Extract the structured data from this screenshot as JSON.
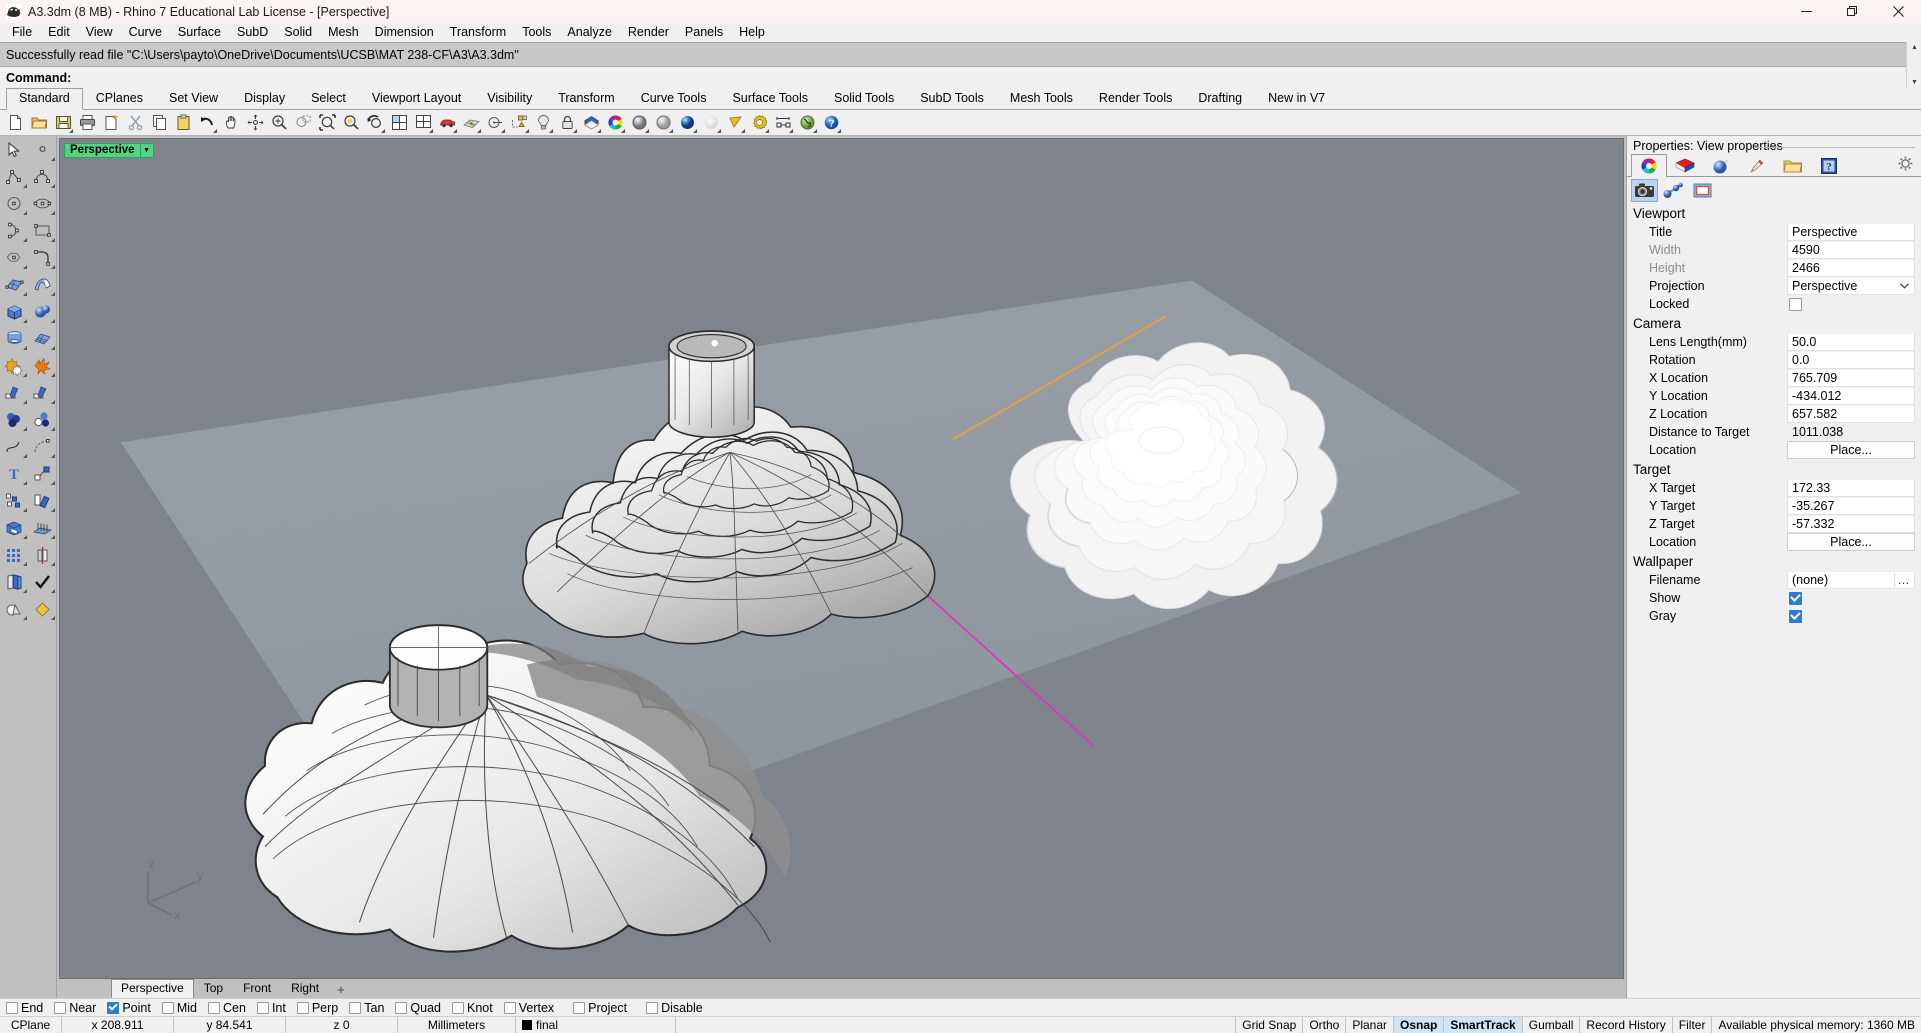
{
  "window": {
    "title": "A3.3dm (8 MB) - Rhino 7 Educational Lab License - [Perspective]",
    "app_icon": "rhino-logo-icon",
    "minimize": "–",
    "restore": "❐",
    "close": "✕"
  },
  "menubar": {
    "items": [
      {
        "label": "File"
      },
      {
        "label": "Edit"
      },
      {
        "label": "View"
      },
      {
        "label": "Curve"
      },
      {
        "label": "Surface"
      },
      {
        "label": "SubD"
      },
      {
        "label": "Solid"
      },
      {
        "label": "Mesh"
      },
      {
        "label": "Dimension"
      },
      {
        "label": "Transform"
      },
      {
        "label": "Tools"
      },
      {
        "label": "Analyze"
      },
      {
        "label": "Render"
      },
      {
        "label": "Panels"
      },
      {
        "label": "Help"
      }
    ]
  },
  "command": {
    "history": "Successfully read file \"C:\\Users\\payto\\OneDrive\\Documents\\UCSB\\MAT 238-CF\\A3\\A3.3dm\"",
    "prompt_label": "Command:",
    "prompt_value": "",
    "scroll_up": "▲",
    "scroll_down": "▼"
  },
  "toolbar_tabs": {
    "active": "Standard",
    "items": [
      {
        "label": "Standard"
      },
      {
        "label": "CPlanes"
      },
      {
        "label": "Set View"
      },
      {
        "label": "Display"
      },
      {
        "label": "Select"
      },
      {
        "label": "Viewport Layout"
      },
      {
        "label": "Visibility"
      },
      {
        "label": "Transform"
      },
      {
        "label": "Curve Tools"
      },
      {
        "label": "Surface Tools"
      },
      {
        "label": "Solid Tools"
      },
      {
        "label": "SubD Tools"
      },
      {
        "label": "Mesh Tools"
      },
      {
        "label": "Render Tools"
      },
      {
        "label": "Drafting"
      },
      {
        "label": "New in V7"
      }
    ]
  },
  "main_toolbar": {
    "buttons": [
      {
        "name": "new-file-icon",
        "tip": "New"
      },
      {
        "name": "open-file-icon",
        "tip": "Open"
      },
      {
        "name": "save-file-icon",
        "tip": "Save"
      },
      {
        "name": "print-icon",
        "tip": "Print"
      },
      {
        "name": "cut-page-icon",
        "tip": "Cut page"
      },
      {
        "name": "scissors-cut-icon",
        "tip": "Cut"
      },
      {
        "name": "copy-icon",
        "tip": "Copy"
      },
      {
        "name": "paste-clipboard-icon",
        "tip": "Paste"
      },
      {
        "name": "undo-arrow-icon",
        "tip": "Undo"
      },
      {
        "name": "pan-hand-icon",
        "tip": "Pan"
      },
      {
        "name": "rotate-view-icon",
        "tip": "Rotate view"
      },
      {
        "name": "zoom-in-icon",
        "tip": "Zoom in"
      },
      {
        "name": "zoom-window-icon",
        "tip": "Zoom window"
      },
      {
        "name": "zoom-extents-icon",
        "tip": "Zoom extents"
      },
      {
        "name": "zoom-selected-icon",
        "tip": "Zoom selected"
      },
      {
        "name": "zoom-previous-icon",
        "tip": "Zoom previous"
      },
      {
        "name": "viewport-4-icon",
        "tip": "4 viewports"
      },
      {
        "name": "viewport-split-icon",
        "tip": "Split viewport"
      },
      {
        "name": "car-render-icon",
        "tip": "Render"
      },
      {
        "name": "cplane-grid-icon",
        "tip": "CPlane"
      },
      {
        "name": "named-view-icon",
        "tip": "Named view"
      },
      {
        "name": "layer-state-icon",
        "tip": "Layers"
      },
      {
        "name": "light-bulb-icon",
        "tip": "Lights"
      },
      {
        "name": "lock-icon",
        "tip": "Lock"
      },
      {
        "name": "layers-stack-icon",
        "tip": "Layers panel"
      },
      {
        "name": "color-wheel-icon",
        "tip": "Color"
      },
      {
        "name": "shaded-sphere-icon",
        "tip": "Shaded"
      },
      {
        "name": "ghosted-sphere-icon",
        "tip": "Ghosted"
      },
      {
        "name": "rendered-sphere-icon",
        "tip": "Rendered"
      },
      {
        "name": "arctic-sphere-icon",
        "tip": "Arctic"
      },
      {
        "name": "cone-display-icon",
        "tip": "Display mode"
      },
      {
        "name": "gear-options-icon",
        "tip": "Options"
      },
      {
        "name": "dimension-icon",
        "tip": "Dimension"
      },
      {
        "name": "earth-globe-icon",
        "tip": "Globe"
      },
      {
        "name": "help-question-icon",
        "tip": "Help"
      }
    ]
  },
  "left_palette": {
    "buttons": [
      {
        "name": "select-arrow-icon"
      },
      {
        "name": "point-icon"
      },
      {
        "name": "polyline-icon"
      },
      {
        "name": "curve-icon"
      },
      {
        "name": "circle-icon"
      },
      {
        "name": "ellipse-icon"
      },
      {
        "name": "arc-icon"
      },
      {
        "name": "rectangle-icon"
      },
      {
        "name": "polygon-icon"
      },
      {
        "name": "fillet-curve-icon"
      },
      {
        "name": "surface-from-points-icon"
      },
      {
        "name": "loft-surface-icon"
      },
      {
        "name": "box-solid-icon"
      },
      {
        "name": "sphere-solid-icon"
      },
      {
        "name": "cylinder-solid-icon"
      },
      {
        "name": "mesh-icon"
      },
      {
        "name": "boolean-union-icon"
      },
      {
        "name": "explode-icon"
      },
      {
        "name": "trim-icon"
      },
      {
        "name": "split-icon"
      },
      {
        "name": "boolean-difference-icon"
      },
      {
        "name": "boolean-circles-icon"
      },
      {
        "name": "blend-curve-icon"
      },
      {
        "name": "extend-curve-icon"
      },
      {
        "name": "text-tool-icon"
      },
      {
        "name": "move-object-icon"
      },
      {
        "name": "scatter-copy-icon"
      },
      {
        "name": "rotate-object-icon"
      },
      {
        "name": "cap-solid-icon"
      },
      {
        "name": "array-linear-icon"
      },
      {
        "name": "array-grid-icon"
      },
      {
        "name": "mirror-icon"
      },
      {
        "name": "layers-book-icon"
      },
      {
        "name": "checkmark-icon"
      },
      {
        "name": "render-mesh-icon"
      },
      {
        "name": "gold-diamond-icon"
      }
    ]
  },
  "viewport": {
    "label": "Perspective",
    "dropdown_caret": "▼",
    "axis_labels": {
      "x": "x",
      "y": "y",
      "z": "z"
    },
    "tabs": [
      {
        "label": "Perspective",
        "active": true
      },
      {
        "label": "Top",
        "active": false
      },
      {
        "label": "Front",
        "active": false
      },
      {
        "label": "Right",
        "active": false
      },
      {
        "label": "+",
        "active": false
      }
    ]
  },
  "properties": {
    "panel_title": "Properties: View properties",
    "tabs": [
      {
        "name": "object-properties-tab",
        "icon": "color-wheel-icon",
        "active": true
      },
      {
        "name": "material-tab",
        "icon": "material-swatch-icon",
        "active": false
      },
      {
        "name": "environment-tab",
        "icon": "environment-sphere-icon",
        "active": false
      },
      {
        "name": "texture-tab",
        "icon": "paintbrush-icon",
        "active": false
      },
      {
        "name": "files-tab",
        "icon": "folder-icon",
        "active": false
      },
      {
        "name": "help-tab",
        "icon": "help-panel-icon",
        "active": false
      }
    ],
    "gear": "gear-icon",
    "subtabs": [
      {
        "name": "camera-subtab",
        "icon": "camera-icon",
        "selected": true
      },
      {
        "name": "clipping-subtab",
        "icon": "molecule-icon",
        "selected": false
      },
      {
        "name": "frame-subtab",
        "icon": "frame-icon",
        "selected": false
      }
    ],
    "sections": [
      {
        "title": "Viewport",
        "rows": [
          {
            "label": "Title",
            "value": "Perspective",
            "type": "text",
            "dim": false
          },
          {
            "label": "Width",
            "value": "4590",
            "type": "text",
            "dim": true
          },
          {
            "label": "Height",
            "value": "2466",
            "type": "text",
            "dim": true
          },
          {
            "label": "Projection",
            "value": "Perspective",
            "type": "select",
            "dim": false
          },
          {
            "label": "Locked",
            "value": "",
            "type": "checkbox",
            "checked": false,
            "dim": false
          }
        ]
      },
      {
        "title": "Camera",
        "rows": [
          {
            "label": "Lens Length(mm)",
            "value": "50.0",
            "type": "text",
            "dim": false
          },
          {
            "label": "Rotation",
            "value": "0.0",
            "type": "text",
            "dim": false
          },
          {
            "label": "X Location",
            "value": "765.709",
            "type": "text",
            "dim": false
          },
          {
            "label": "Y Location",
            "value": "-434.012",
            "type": "text",
            "dim": false
          },
          {
            "label": "Z Location",
            "value": "657.582",
            "type": "text",
            "dim": false
          },
          {
            "label": "Distance to Target",
            "value": "1011.038",
            "type": "flat",
            "dim": false
          },
          {
            "label": "Location",
            "value": "Place...",
            "type": "button",
            "dim": false
          }
        ]
      },
      {
        "title": "Target",
        "rows": [
          {
            "label": "X Target",
            "value": "172.33",
            "type": "text",
            "dim": false
          },
          {
            "label": "Y Target",
            "value": "-35.267",
            "type": "text",
            "dim": false
          },
          {
            "label": "Z Target",
            "value": "-57.332",
            "type": "text",
            "dim": false
          },
          {
            "label": "Location",
            "value": "Place...",
            "type": "button",
            "dim": false
          }
        ]
      },
      {
        "title": "Wallpaper",
        "rows": [
          {
            "label": "Filename",
            "value": "(none)",
            "type": "file",
            "dim": false
          },
          {
            "label": "Show",
            "value": "",
            "type": "checkbox",
            "checked": true,
            "dim": false
          },
          {
            "label": "Gray",
            "value": "",
            "type": "checkbox",
            "checked": true,
            "dim": false
          }
        ]
      }
    ]
  },
  "osnap": {
    "items": [
      {
        "label": "End",
        "checked": false
      },
      {
        "label": "Near",
        "checked": false
      },
      {
        "label": "Point",
        "checked": true
      },
      {
        "label": "Mid",
        "checked": false
      },
      {
        "label": "Cen",
        "checked": false
      },
      {
        "label": "Int",
        "checked": false
      },
      {
        "label": "Perp",
        "checked": false
      },
      {
        "label": "Tan",
        "checked": false
      },
      {
        "label": "Quad",
        "checked": false
      },
      {
        "label": "Knot",
        "checked": false
      },
      {
        "label": "Vertex",
        "checked": false
      },
      {
        "label": "Project",
        "checked": false
      },
      {
        "label": "Disable",
        "checked": false
      }
    ]
  },
  "statusbar": {
    "cplane": "CPlane",
    "x": "x 208.911",
    "y": "y 84.541",
    "z": "z 0",
    "units": "Millimeters",
    "layer": "final",
    "layer_color": "#000000",
    "toggles": [
      {
        "label": "Grid Snap",
        "active": false
      },
      {
        "label": "Ortho",
        "active": false
      },
      {
        "label": "Planar",
        "active": false
      },
      {
        "label": "Osnap",
        "active": true
      },
      {
        "label": "SmartTrack",
        "active": true
      },
      {
        "label": "Gumball",
        "active": false
      },
      {
        "label": "Record History",
        "active": false
      },
      {
        "label": "Filter",
        "active": false
      }
    ],
    "memory": "Available physical memory: 1360 MB"
  },
  "colors": {
    "viewport_bg": "#7e838c",
    "ground_plane": "#9aa0a8",
    "accent_green": "#4fd481",
    "accent_blue": "#2b7cd3",
    "orange_line": "#f0a030",
    "magenta_line": "#e030c8"
  }
}
